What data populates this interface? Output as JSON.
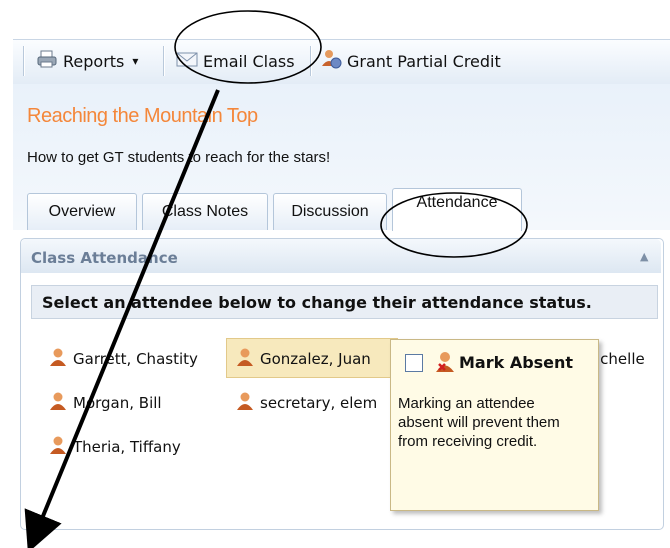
{
  "toolbar": {
    "reports_label": "Reports",
    "dropdown_glyph": "▾",
    "email_label": "Email Class",
    "credit_label": "Grant Partial Credit"
  },
  "class": {
    "title": "Reaching the Mountain Top",
    "description": "How to get GT students to reach for the stars!"
  },
  "tabs": [
    {
      "label": "Overview"
    },
    {
      "label": "Class Notes"
    },
    {
      "label": "Discussion"
    },
    {
      "label": "Attendance",
      "active": true
    }
  ],
  "panel": {
    "title": "Class Attendance",
    "collapse_glyph": "▲",
    "instruction": "Select an attendee below to change their attendance status."
  },
  "attendees": [
    {
      "name": "Garrett, Chastity"
    },
    {
      "name": "Gonzalez, Juan"
    },
    {
      "name": "ichelle"
    },
    {
      "name": "Morgan, Bill"
    },
    {
      "name": "secretary, elem"
    },
    {
      "name": "Theria, Tiffany"
    }
  ],
  "popup": {
    "title": "Mark Absent",
    "text": "Marking an attendee absent will prevent them from receiving credit."
  },
  "colors": {
    "accent_title": "#f4873a",
    "annotation": "#000000"
  },
  "icons": [
    "printer-icon",
    "email-icon",
    "users-credit-icon",
    "user-icon",
    "user-remove-icon"
  ]
}
